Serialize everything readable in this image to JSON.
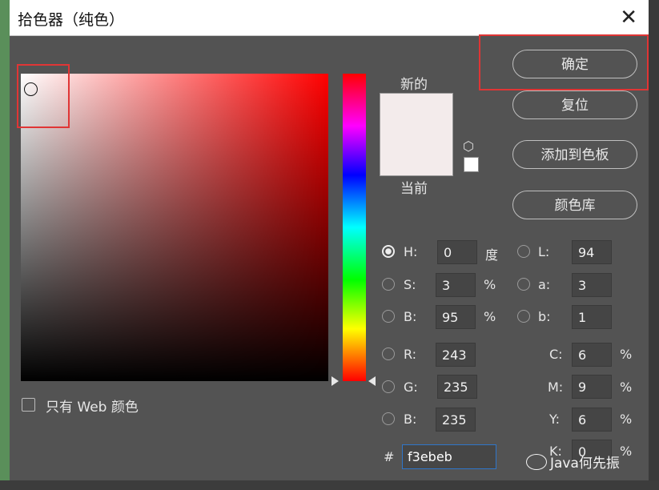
{
  "dialog": {
    "title": "拾色器（纯色）",
    "close_glyph": "✕"
  },
  "preview": {
    "new_label": "新的",
    "current_label": "当前",
    "color": "#f3ebeb"
  },
  "web_only": {
    "label": "只有 Web 颜色",
    "checked": false
  },
  "buttons": {
    "ok": "确定",
    "reset": "复位",
    "add_swatch": "添加到色板",
    "libraries": "颜色库"
  },
  "hsb": {
    "h": {
      "label": "H:",
      "value": "0",
      "unit": "度",
      "selected": true
    },
    "s": {
      "label": "S:",
      "value": "3",
      "unit": "%"
    },
    "b": {
      "label": "B:",
      "value": "95",
      "unit": "%"
    }
  },
  "rgb": {
    "r": {
      "label": "R:",
      "value": "243"
    },
    "g": {
      "label": "G:",
      "value": "235"
    },
    "b": {
      "label": "B:",
      "value": "235"
    }
  },
  "lab": {
    "l": {
      "label": "L:",
      "value": "94"
    },
    "a": {
      "label": "a:",
      "value": "3"
    },
    "b": {
      "label": "b:",
      "value": "1"
    }
  },
  "cmyk": {
    "c": {
      "label": "C:",
      "value": "6",
      "unit": "%"
    },
    "m": {
      "label": "M:",
      "value": "9",
      "unit": "%"
    },
    "y": {
      "label": "Y:",
      "value": "6",
      "unit": "%"
    },
    "k": {
      "label": "K:",
      "value": "0",
      "unit": "%"
    }
  },
  "hex": {
    "label": "#",
    "value": "f3ebeb"
  },
  "watermark": "Java何先振",
  "icons": {
    "close": "close-icon",
    "cube": "cube-icon",
    "watermark": "wechat-icon"
  },
  "colors": {
    "dialog_bg": "#535353",
    "highlight": "#e03535",
    "hex_focus": "#2f76c9"
  }
}
